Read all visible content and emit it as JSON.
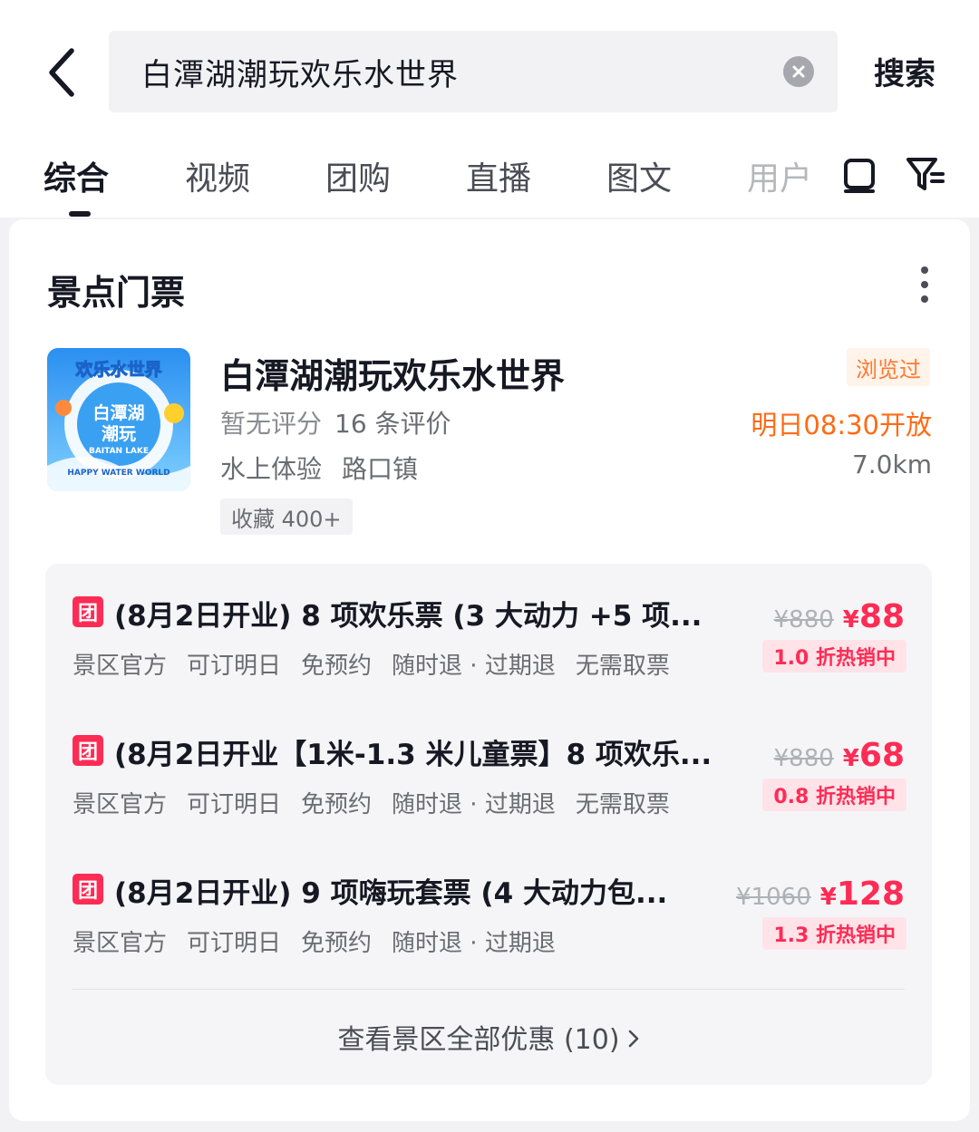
{
  "search": {
    "query": "白潭湖潮玩欢乐水世界",
    "button_label": "搜索"
  },
  "tabs": [
    {
      "label": "综合",
      "active": true
    },
    {
      "label": "视频",
      "active": false
    },
    {
      "label": "团购",
      "active": false
    },
    {
      "label": "直播",
      "active": false
    },
    {
      "label": "图文",
      "active": false
    },
    {
      "label": "用户",
      "active": false
    }
  ],
  "icons": {
    "back": "chevron-left-icon",
    "clear": "close-circle-icon",
    "layout": "phone-frame-icon",
    "filter": "filter-icon",
    "more": "more-vertical-icon"
  },
  "section": {
    "title": "景点门票"
  },
  "poi": {
    "thumbnail_text": {
      "top": "欢乐水世界",
      "middle": "白潭湖潮玩",
      "en": "BAITAN LAKE",
      "arc": "HAPPY WATER WORLD"
    },
    "name": "白潭湖潮玩欢乐水世界",
    "visited_badge": "浏览过",
    "rating_text": "暂无评分",
    "reviews_text": "16 条评价",
    "open_time": "明日08:30开放",
    "tags": [
      "水上体验",
      "路口镇"
    ],
    "distance": "7.0km",
    "favorites": "收藏 400+"
  },
  "deals": [
    {
      "badge": "团",
      "title": "(8月2日开业) 8 项欢乐票 (3 大动力 +5 项...",
      "tags": [
        "景区官方",
        "可订明日",
        "免预约",
        "随时退 · 过期退",
        "无需取票"
      ],
      "original_price": "¥880",
      "currency": "¥",
      "price": "88",
      "discount": "1.0 折热销中"
    },
    {
      "badge": "团",
      "title": "(8月2日开业【1米-1.3 米儿童票】8 项欢乐...",
      "tags": [
        "景区官方",
        "可订明日",
        "免预约",
        "随时退 · 过期退",
        "无需取票"
      ],
      "original_price": "¥880",
      "currency": "¥",
      "price": "68",
      "discount": "0.8 折热销中"
    },
    {
      "badge": "团",
      "title": "(8月2日开业) 9 项嗨玩套票 (4 大动力包...",
      "tags": [
        "景区官方",
        "可订明日",
        "免预约",
        "随时退 · 过期退"
      ],
      "original_price": "¥1060",
      "currency": "¥",
      "price": "128",
      "discount": "1.3 折热销中"
    }
  ],
  "view_all": {
    "label": "查看景区全部优惠 (10)"
  },
  "colors": {
    "accent": "#fe2c55",
    "orange": "#ff6a14",
    "text_primary": "#161823",
    "text_secondary": "#6b6c72"
  }
}
